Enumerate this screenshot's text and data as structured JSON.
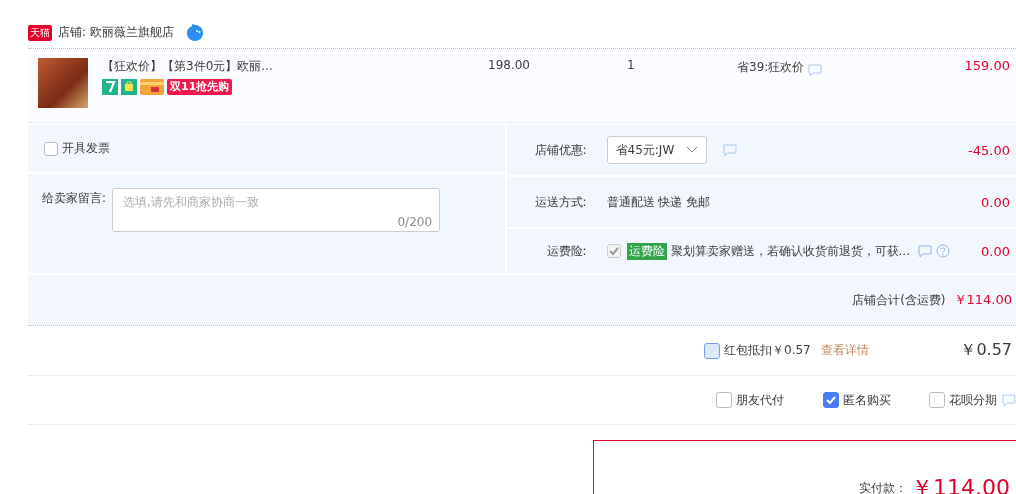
{
  "shop": {
    "badge": "天猫",
    "label": "店铺: 欧丽薇兰旗舰店"
  },
  "item": {
    "title": "【狂欢价】【第3件0元】欧丽...",
    "promo_tag": "双11抢先购",
    "price": "198.00",
    "quantity": "1",
    "discount": "省39:狂欢价",
    "subtotal": "159.00"
  },
  "invoice": {
    "label": "开具发票",
    "checked": false
  },
  "message": {
    "label": "给卖家留言:",
    "placeholder": "选填,请先和商家协商一致",
    "counter": "0/200"
  },
  "options": [
    {
      "kind": "select",
      "label": "店铺优惠:",
      "value": "省45元:JW",
      "amount": "-45.00"
    },
    {
      "kind": "text",
      "label": "运送方式:",
      "value": "普通配送 快递 免邮",
      "amount": "0.00"
    },
    {
      "kind": "insurance",
      "label": "运费险:",
      "checked": true,
      "disabled": true,
      "tag": "运费险",
      "value": "聚划算卖家赠送，若确认收货前退货，可获...",
      "amount": "0.00"
    }
  ],
  "shop_total": {
    "label": "店铺合计(含运费)",
    "amount": "￥114.00"
  },
  "red_envelope": {
    "label": "红包抵扣￥0.57",
    "checked": false,
    "link": "查看详情",
    "amount": "￥0.57"
  },
  "pay_options": [
    {
      "label": "朋友代付",
      "checked": false
    },
    {
      "label": "匿名购买",
      "checked": true
    },
    {
      "label": "花呗分期",
      "checked": false
    }
  ],
  "payment": {
    "label": "实付款：",
    "amount": "￥114.00"
  }
}
